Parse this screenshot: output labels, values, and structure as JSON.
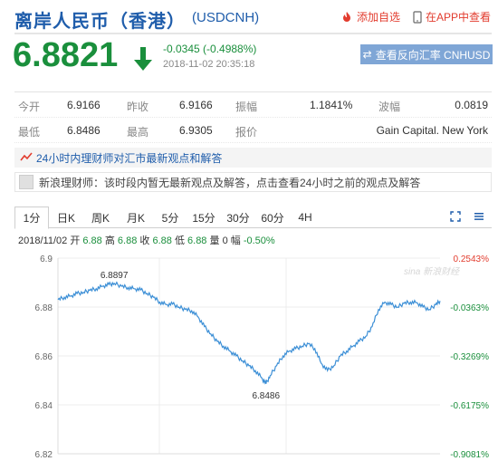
{
  "header": {
    "title": "离岸人民币（香港）",
    "code": "(USDCNH)",
    "add_watch": "添加自选",
    "view_app": "在APP中查看"
  },
  "quote": {
    "price": "6.8821",
    "change": "-0.0345 (-0.4988%)",
    "datetime": "2018-11-02 20:35:18",
    "reverse_button": "查看反向汇率 CNHUSD"
  },
  "table": {
    "row1": {
      "l1": "今开",
      "v1": "6.9166",
      "l2": "昨收",
      "v2": "6.9166",
      "l3": "振幅",
      "v3": "1.1841%",
      "l4": "波幅",
      "v4": "0.0819"
    },
    "row2": {
      "l1": "最低",
      "v1": "6.8486",
      "l2": "最高",
      "v2": "6.9305",
      "l3": "报价",
      "v4": "Gain Capital. New York"
    }
  },
  "notice": "24小时内理财师对汇市最新观点和解答",
  "advisor": "新浪理财师：该时段内暂无最新观点及解答，点击查看24小时之前的观点及解答",
  "tabs": [
    "1分",
    "日K",
    "周K",
    "月K",
    "5分",
    "15分",
    "30分",
    "60分",
    "4H"
  ],
  "status": {
    "date": "2018/11/02",
    "open_label": "开",
    "open": "6.88",
    "high_label": "高",
    "high": "6.88",
    "close_label": "收",
    "close": "6.88",
    "low_label": "低",
    "low": "6.88",
    "vol_label": "量",
    "vol": "0",
    "amp_label": "幅",
    "amp": "-0.50%"
  },
  "chart_data": {
    "type": "line",
    "ylim": [
      6.82,
      6.9
    ],
    "y_ticks": [
      "6.9",
      "6.88",
      "6.86",
      "6.84",
      "6.82"
    ],
    "right_ticks": [
      "0.2543%",
      "-0.0363%",
      "-0.3269%",
      "-0.6175%",
      "-0.9081%"
    ],
    "watermark": "sina 新浪财经",
    "annotations": [
      {
        "text": "6.8897",
        "x": 53,
        "y": 6.8897
      },
      {
        "text": "6.8486",
        "x": 196,
        "y": 6.8486
      }
    ],
    "x": [
      0,
      6,
      12,
      18,
      24,
      30,
      36,
      42,
      48,
      53,
      60,
      66,
      72,
      78,
      84,
      90,
      96,
      102,
      108,
      114,
      120,
      126,
      132,
      138,
      144,
      150,
      156,
      162,
      168,
      174,
      180,
      186,
      192,
      196,
      200,
      206,
      212,
      218,
      224,
      230,
      236,
      242,
      248,
      254,
      260,
      266,
      272,
      278,
      284,
      290,
      296,
      302,
      308,
      314,
      320,
      326,
      332,
      338,
      344,
      350,
      356,
      360
    ],
    "y": [
      6.883,
      6.884,
      6.8845,
      6.8855,
      6.886,
      6.8868,
      6.8875,
      6.8885,
      6.8892,
      6.8897,
      6.8885,
      6.888,
      6.8875,
      6.887,
      6.8855,
      6.884,
      6.882,
      6.881,
      6.8812,
      6.88,
      6.879,
      6.8785,
      6.876,
      6.872,
      6.869,
      6.866,
      6.864,
      6.862,
      6.86,
      6.858,
      6.856,
      6.854,
      6.851,
      6.8486,
      6.852,
      6.856,
      6.86,
      6.862,
      6.863,
      6.864,
      6.865,
      6.863,
      6.857,
      6.854,
      6.856,
      6.86,
      6.862,
      6.864,
      6.866,
      6.868,
      6.872,
      6.879,
      6.882,
      6.881,
      6.88,
      6.8815,
      6.882,
      6.8818,
      6.88,
      6.879,
      6.881,
      6.8825
    ],
    "grid": true
  },
  "colors": {
    "accent": "#1f5dab",
    "down": "#1a8f3c",
    "up": "#e23c2e",
    "line": "#3c8fd6"
  }
}
